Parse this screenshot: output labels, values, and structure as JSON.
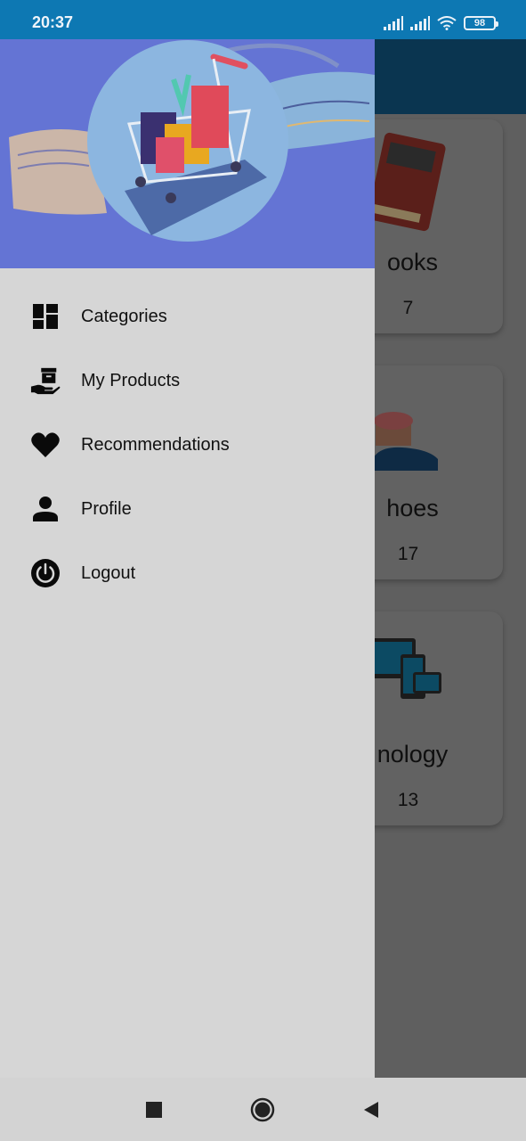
{
  "status_bar": {
    "time": "20:37",
    "battery": "98",
    "icons": [
      "signal-icon",
      "signal-icon",
      "wifi-icon",
      "battery-icon"
    ]
  },
  "background": {
    "cards": [
      {
        "name_partial": "ooks",
        "count_partial": "7"
      },
      {
        "name_partial": "hoes",
        "count_partial": "17"
      },
      {
        "name_partial": "nology",
        "count_partial": "13"
      }
    ]
  },
  "drawer": {
    "header_image": "shopping-cart-illustration",
    "menu": [
      {
        "label": "Categories",
        "icon": "dashboard-icon"
      },
      {
        "label": "My Products",
        "icon": "hand-box-icon"
      },
      {
        "label": "Recommendations",
        "icon": "heart-icon"
      },
      {
        "label": "Profile",
        "icon": "person-icon"
      },
      {
        "label": "Logout",
        "icon": "power-icon"
      }
    ]
  },
  "nav_bar": {
    "buttons": [
      "recents-button",
      "home-button",
      "back-button"
    ]
  },
  "colors": {
    "status_bar": "#0d78b3",
    "drawer_header": "#6474d4",
    "drawer_bg": "#d6d6d6",
    "scrim": "#5f5f5f"
  }
}
